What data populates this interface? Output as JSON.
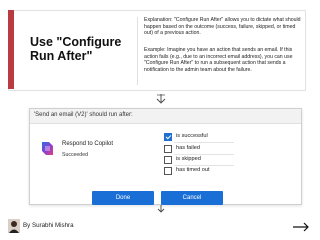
{
  "card": {
    "title": "Use \"Configure Run After\"",
    "explanation": "Explanation: \"Configure Run After\" allows you to dictate what should happen based on the outcome (success, failure, skipped, or timed out) of a previous action.",
    "example": "Example: Imagine you have an action that sends an email. If this action fails (e.g., due to an incorrect email address), you can use \"Configure Run After\" to run a subsequent action that sends a notification to the admin team about the failure."
  },
  "dialog": {
    "title": "'Send an email (V2)' should run after:",
    "action_name": "Respond to Copilot",
    "action_status": "Succeeded",
    "options": [
      {
        "label": "is successful",
        "checked": true
      },
      {
        "label": "has failed",
        "checked": false
      },
      {
        "label": "is skipped",
        "checked": false
      },
      {
        "label": "has timed out",
        "checked": false
      }
    ],
    "done_label": "Done",
    "cancel_label": "Cancel"
  },
  "footer": {
    "author": "By Surabhi Mishra"
  },
  "colors": {
    "accent": "#b93a3f",
    "primary_button": "#1a6fd6",
    "checkbox_checked": "#1f6fd0"
  }
}
